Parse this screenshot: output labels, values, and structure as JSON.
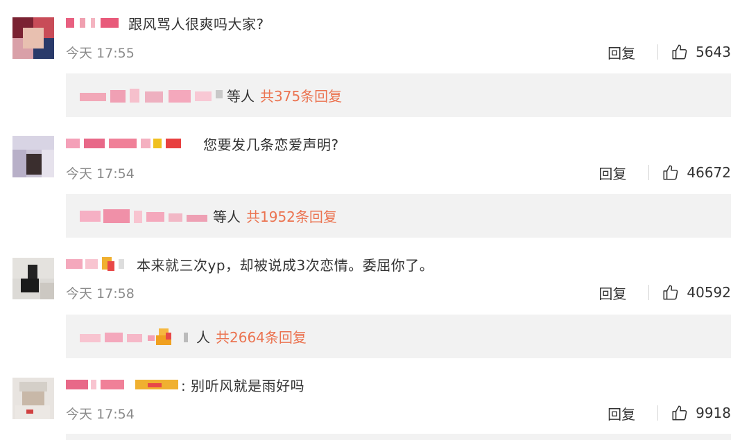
{
  "comments": [
    {
      "text": "跟风骂人很爽吗大家?",
      "time": "今天 17:55",
      "reply_label": "回复",
      "likes": "5643",
      "reply_by_suffix": "等人",
      "reply_total": "共375条回复"
    },
    {
      "text": "您要发几条恋爱声明?",
      "time": "今天 17:54",
      "reply_label": "回复",
      "likes": "46672",
      "reply_by_suffix": "等人",
      "reply_total": "共1952条回复"
    },
    {
      "text": "本来就三次yp，却被说成3次恋情。委屈你了。",
      "time": "今天 17:58",
      "reply_label": "回复",
      "likes": "40592",
      "reply_by_suffix": "人",
      "reply_total": "共2664条回复"
    },
    {
      "text": ": 别听风就是雨好吗",
      "time": "今天 17:54",
      "reply_label": "回复",
      "likes": "9918"
    }
  ],
  "icons": {
    "like": "thumbs-up-icon"
  },
  "colors": {
    "accent": "#eb7350",
    "reply_bg": "#f2f2f2",
    "muted": "#8a8a8a"
  }
}
